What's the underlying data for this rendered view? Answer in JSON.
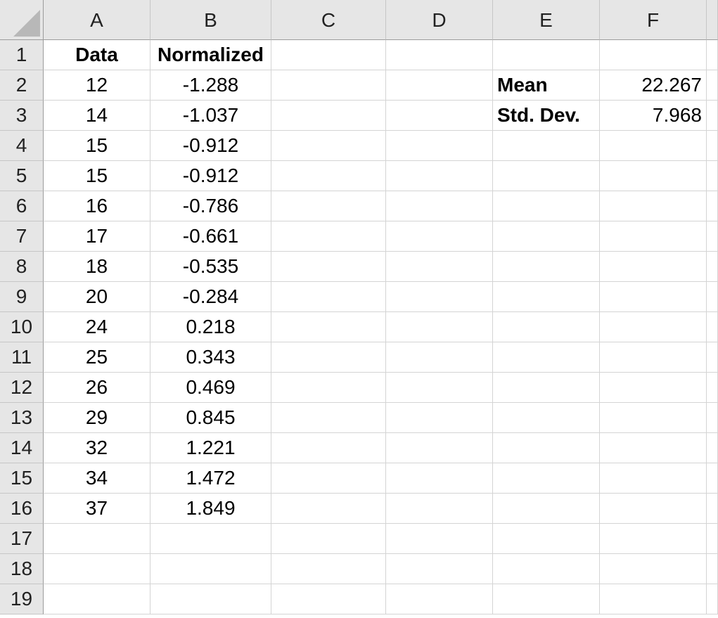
{
  "columns": [
    "A",
    "B",
    "C",
    "D",
    "E",
    "F"
  ],
  "rows": [
    "1",
    "2",
    "3",
    "4",
    "5",
    "6",
    "7",
    "8",
    "9",
    "10",
    "11",
    "12",
    "13",
    "14",
    "15",
    "16",
    "17",
    "18",
    "19"
  ],
  "cells": {
    "A1": "Data",
    "B1": "Normalized",
    "A2": "12",
    "B2": "-1.288",
    "E2": "Mean",
    "F2": "22.267",
    "A3": "14",
    "B3": "-1.037",
    "E3": "Std. Dev.",
    "F3": "7.968",
    "A4": "15",
    "B4": "-0.912",
    "A5": "15",
    "B5": "-0.912",
    "A6": "16",
    "B6": "-0.786",
    "A7": "17",
    "B7": "-0.661",
    "A8": "18",
    "B8": "-0.535",
    "A9": "20",
    "B9": "-0.284",
    "A10": "24",
    "B10": "0.218",
    "A11": "25",
    "B11": "0.343",
    "A12": "26",
    "B12": "0.469",
    "A13": "29",
    "B13": "0.845",
    "A14": "32",
    "B14": "1.221",
    "A15": "34",
    "B15": "1.472",
    "A16": "37",
    "B16": "1.849"
  },
  "colors": {
    "header_background": "#e6e6e6",
    "gridline": "#d4d4d4",
    "header_border": "#9b9b9b"
  }
}
